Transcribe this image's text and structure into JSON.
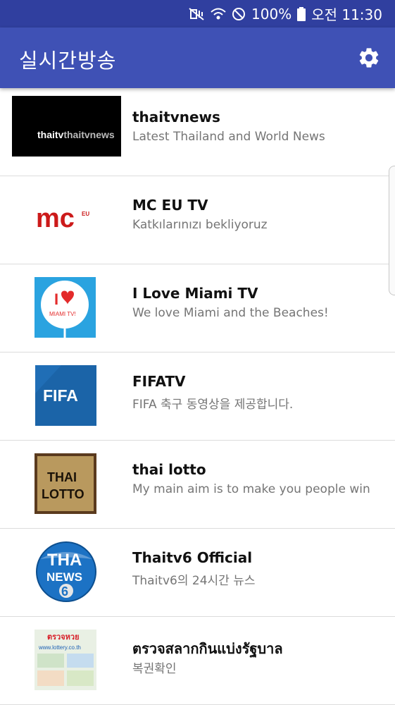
{
  "status_bar": {
    "battery": "100%",
    "time": "오전 11:30",
    "icons": [
      "mute-vibrate-icon",
      "wifi-icon",
      "no-disturb-icon",
      "battery-icon"
    ]
  },
  "app_bar": {
    "title": "실시간방송",
    "settings_icon": "gear-icon"
  },
  "channels": [
    {
      "name": "thaitvnews",
      "subtitle": "Latest Thailand and World News",
      "logo_text": "thaitvnews"
    },
    {
      "name": "MC EU TV",
      "subtitle": "Katkılarınızı bekliyoruz",
      "logo_text": "mc",
      "logo_sub": "EU"
    },
    {
      "name": "I Love Miami TV",
      "subtitle": "We love Miami and the Beaches!",
      "logo_text": "I",
      "logo_sub": "MIAMI TV!"
    },
    {
      "name": "FIFATV",
      "subtitle": "FIFA 축구 동영상을 제공합니다.",
      "logo_text": "FIFA"
    },
    {
      "name": "thai lotto",
      "subtitle": "My main aim is to make you people win",
      "logo_text": "THAI",
      "logo_sub": "LOTTO"
    },
    {
      "name": "Thaitv6 Official",
      "subtitle": "Thaitv6의 24시간 뉴스",
      "logo_text": "THA",
      "logo_sub": "NEWS",
      "logo_num": "6"
    },
    {
      "name": "ตรวจสลากกินแบ่งรัฐบาล",
      "subtitle": "복권확인",
      "logo_text": "ตรวจหวย",
      "logo_sub": "www.lottery.co.th"
    }
  ],
  "colors": {
    "status_bar": "#303f9f",
    "app_bar": "#3f51b5",
    "divider": "#dcdcdc",
    "subtitle": "#757575"
  }
}
